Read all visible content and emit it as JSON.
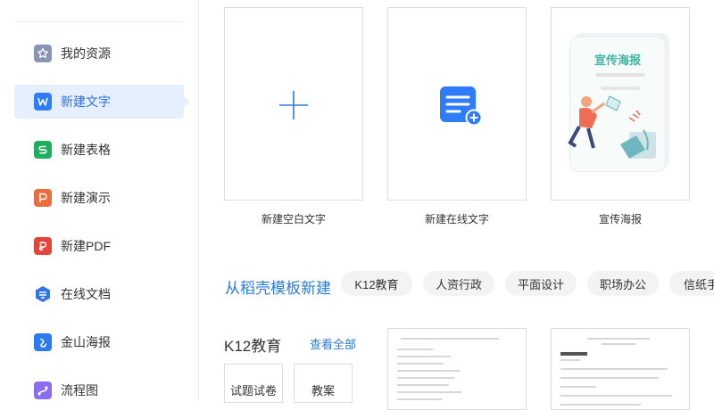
{
  "sidebar": {
    "items": [
      {
        "label": "我的资源",
        "icon": "star-icon",
        "color": "#8a94b4",
        "active": false
      },
      {
        "label": "新建文字",
        "icon": "word-doc-icon",
        "color": "#2e7cf6",
        "active": true
      },
      {
        "label": "新建表格",
        "icon": "spreadsheet-icon",
        "color": "#1dae5e",
        "active": false
      },
      {
        "label": "新建演示",
        "icon": "presentation-icon",
        "color": "#ee6b3c",
        "active": false
      },
      {
        "label": "新建PDF",
        "icon": "pdf-icon",
        "color": "#e4453b",
        "active": false
      },
      {
        "label": "在线文档",
        "icon": "online-doc-icon",
        "color": "#2f73e8",
        "active": false
      },
      {
        "label": "金山海报",
        "icon": "poster-icon",
        "color": "#2b7bf0",
        "active": false
      },
      {
        "label": "流程图",
        "icon": "flowchart-icon",
        "color": "#8a6df0",
        "active": false
      }
    ]
  },
  "cards": [
    {
      "label": "新建空白文字",
      "icon": "plus-icon"
    },
    {
      "label": "新建在线文字",
      "icon": "online-doc-plus-icon"
    },
    {
      "label": "宣传海报",
      "poster_title": "宣传海报"
    }
  ],
  "templates": {
    "title": "从稻壳模板新建",
    "chips": [
      "K12教育",
      "人资行政",
      "平面设计",
      "职场办公",
      "信纸手"
    ]
  },
  "k12": {
    "title": "K12教育",
    "see_all": "查看全部",
    "buttons": [
      "试题试卷",
      "教案"
    ]
  },
  "colors": {
    "accent": "#2b7bd8",
    "active_bg": "#e6effd"
  }
}
